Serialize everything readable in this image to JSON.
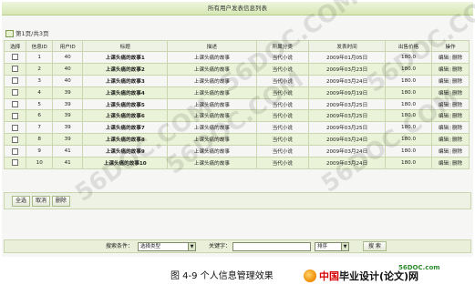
{
  "header": {
    "title": "所有用户发表信息列表"
  },
  "pager": {
    "text": "第1页/共3页"
  },
  "table": {
    "columns": [
      "选择",
      "信息ID",
      "用户ID",
      "标题",
      "描述",
      "所属分类",
      "发表时间",
      "出售价格",
      "操作"
    ],
    "rows": [
      {
        "id": "1",
        "user_id": "40",
        "title": "上课头痛的故事1",
        "desc": "上课头痛的故事",
        "category": "当代小说",
        "time": "2009年01月05日",
        "price": "180.0"
      },
      {
        "id": "2",
        "user_id": "40",
        "title": "上课头痛的故事2",
        "desc": "上课头痛的故事",
        "category": "当代小说",
        "time": "2009年03月23日",
        "price": "180.0"
      },
      {
        "id": "3",
        "user_id": "40",
        "title": "上课头痛的故事3",
        "desc": "上课头痛的故事",
        "category": "当代小说",
        "time": "2009年03月24日",
        "price": "180.0"
      },
      {
        "id": "4",
        "user_id": "39",
        "title": "上课头痛的故事4",
        "desc": "上课头痛的故事",
        "category": "当代小说",
        "time": "2009年09月19日",
        "price": "180.0"
      },
      {
        "id": "5",
        "user_id": "39",
        "title": "上课头痛的故事5",
        "desc": "上课头痛的故事",
        "category": "当代小说",
        "time": "2009年03月25日",
        "price": "180.0"
      },
      {
        "id": "6",
        "user_id": "39",
        "title": "上课头痛的故事6",
        "desc": "上课头痛的故事",
        "category": "当代小说",
        "time": "2009年03月25日",
        "price": "180.0"
      },
      {
        "id": "7",
        "user_id": "39",
        "title": "上课头痛的故事7",
        "desc": "上课头痛的故事",
        "category": "当代小说",
        "time": "2009年03月25日",
        "price": "180.0"
      },
      {
        "id": "8",
        "user_id": "39",
        "title": "上课头痛的故事8",
        "desc": "上课头痛的故事",
        "category": "当代小说",
        "time": "2009年03月24日",
        "price": "180.0"
      },
      {
        "id": "9",
        "user_id": "41",
        "title": "上课头痛的故事9",
        "desc": "上课头痛的故事",
        "category": "当代小说",
        "time": "2009年03月24日",
        "price": "180.0"
      },
      {
        "id": "10",
        "user_id": "41",
        "title": "上课头痛的故事10",
        "desc": "上课头痛的故事",
        "category": "当代小说",
        "time": "2009年03月24日",
        "price": "180.0"
      }
    ],
    "edit_label": "编辑",
    "delete_label": "删除",
    "action_sep": "|"
  },
  "actions": {
    "select_all": "全选",
    "cancel": "取消",
    "delete": "删除"
  },
  "search": {
    "condition_label": "搜索条件：",
    "type_selected": "选择类型",
    "keyword_label": "关键字：",
    "sort_selected": "排序",
    "search_button": "搜 索"
  },
  "caption": "图 4-9  个人信息管理效果",
  "logo": {
    "site": "56DOC.com",
    "brand_red": "中国",
    "brand_black": "毕业设计(论文)网"
  },
  "watermark": "56DOC.COM"
}
